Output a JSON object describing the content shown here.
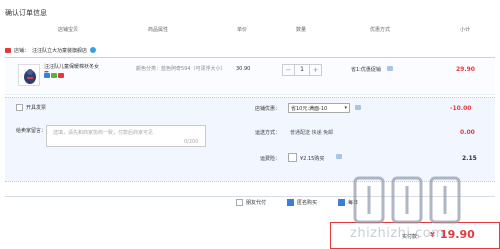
{
  "page": {
    "title": "确认订单信息"
  },
  "columns": [
    "店铺宝贝",
    "商品属性",
    "单价",
    "数量",
    "优惠方式",
    "小计"
  ],
  "shop": {
    "name": "汪汪队立大功童装旗舰店"
  },
  "item": {
    "name": "汪汪队儿童保暖棉袄冬女童...",
    "props": "颜色分类：蓝色阿奇594（可漂浮大小）",
    "price": "30.90",
    "qty": "1",
    "qty_minus": "−",
    "qty_plus": "+",
    "discount": "省1:优惠促销",
    "subtotal": "29.90"
  },
  "invoice_label": "开具发票",
  "message": {
    "label": "给卖家留言：",
    "placeholder": "选填，请先和商家协商一致，付款后商家可见",
    "count": "0/200"
  },
  "shop_discount": {
    "label": "店铺优惠：",
    "option": "省10元:满面-10",
    "value": "-10.00"
  },
  "shipping": {
    "label": "运送方式：",
    "method": "普通配送 快递 免邮",
    "value": "0.00"
  },
  "insurance": {
    "label": "运费险：",
    "text": "¥2.15购买",
    "value": "2.15"
  },
  "footer": {
    "pay_for_other": "朋友代付",
    "anonymous": "匿名购买",
    "partial": "每日"
  },
  "payment": {
    "label": "实付款：",
    "symbol": "¥",
    "value": "19.90"
  },
  "watermark": {
    "text": "zhizhizhi.com"
  },
  "colors": {
    "accent_red": "#e4393c",
    "accent_blue": "#3a7fd8"
  }
}
